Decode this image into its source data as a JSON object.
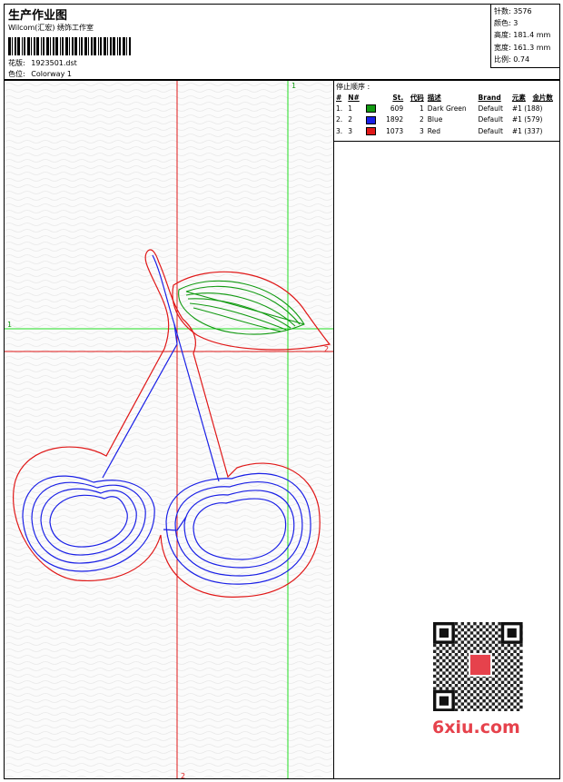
{
  "header": {
    "title": "生产作业图",
    "company": "Wilcom(汇宏) 绣饰工作室",
    "design_label": "花版:",
    "design_value": "1923501.dst",
    "colorway_label": "色位:",
    "colorway_value": "Colorway 1"
  },
  "stats": [
    {
      "label": "针数:",
      "value": "3576"
    },
    {
      "label": "颜色:",
      "value": "3"
    },
    {
      "label": "高度:",
      "value": "181.4 mm"
    },
    {
      "label": "宽度:",
      "value": "161.3 mm"
    },
    {
      "label": "比例:",
      "value": "0.74"
    }
  ],
  "markers": {
    "green_v": "1",
    "green_h": "1",
    "red_v": "2",
    "red_h": "2"
  },
  "stop_sequence": {
    "title": "停止顺序 :",
    "columns": [
      "#",
      "N#",
      "St.",
      "代码",
      "描述",
      "Brand",
      "元素",
      "金片数"
    ],
    "rows": [
      {
        "num": "1.",
        "n": "1",
        "st": "609",
        "code": "1",
        "desc": "Dark Green",
        "brand": "Default",
        "elem": "#1 (188)",
        "color": "#119a11"
      },
      {
        "num": "2.",
        "n": "2",
        "st": "1892",
        "code": "2",
        "desc": "Blue",
        "brand": "Default",
        "elem": "#1 (579)",
        "color": "#1a20e6"
      },
      {
        "num": "3.",
        "n": "3",
        "st": "1073",
        "code": "3",
        "desc": "Red",
        "brand": "Default",
        "elem": "#1 (337)",
        "color": "#e01818"
      }
    ]
  },
  "watermark": {
    "text": "6xiu.com"
  },
  "colors": {
    "green": "#119a11",
    "blue": "#1a20e6",
    "red": "#e01818",
    "guide_green": "#22dd22",
    "guide_red": "#e01818"
  }
}
